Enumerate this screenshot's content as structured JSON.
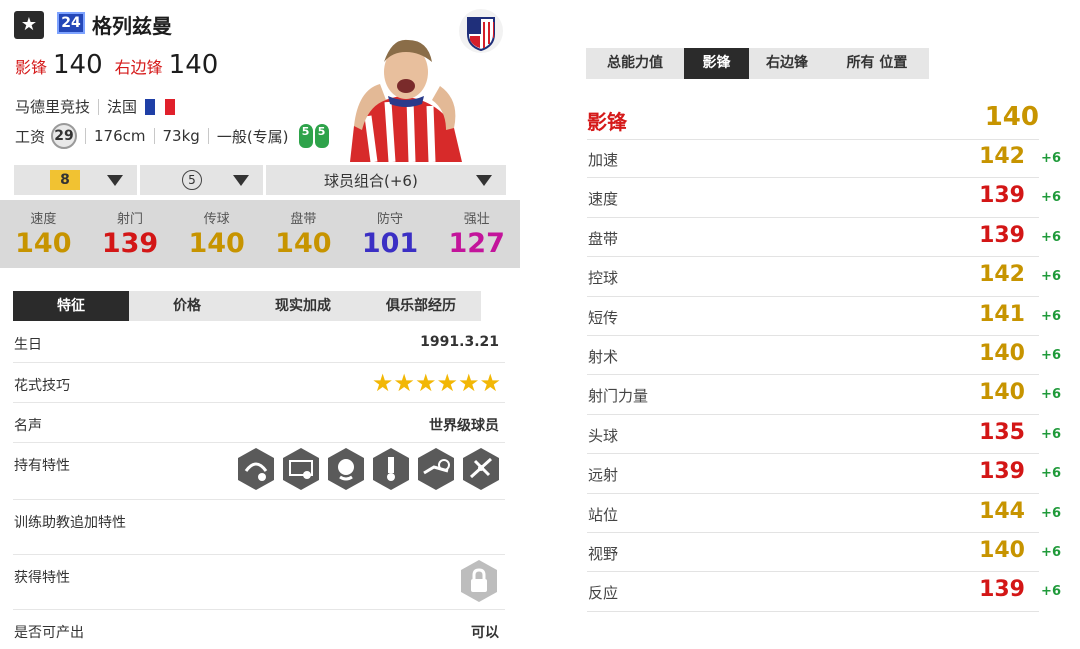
{
  "header": {
    "season_number": "24",
    "player_name": "格列兹曼",
    "positions": [
      {
        "name": "影锋",
        "value": "140"
      },
      {
        "name": "右边锋",
        "value": "140"
      }
    ],
    "club": "马德里竞技",
    "nation": "法国",
    "wage_label": "工资",
    "wage": "29",
    "height": "176cm",
    "weight": "73kg",
    "body_type": "一般(专属)",
    "weak_foot": "5",
    "skill_foot": "5"
  },
  "upgrade": {
    "level": "8",
    "team_color_count": "5",
    "chemistry_label": "球员组合(+6)"
  },
  "main_stats": [
    {
      "label": "速度",
      "value": "140",
      "color": "#c79400"
    },
    {
      "label": "射门",
      "value": "139",
      "color": "#d31616"
    },
    {
      "label": "传球",
      "value": "140",
      "color": "#c79400"
    },
    {
      "label": "盘带",
      "value": "140",
      "color": "#c79400"
    },
    {
      "label": "防守",
      "value": "101",
      "color": "#3b2fc4"
    },
    {
      "label": "强壮",
      "value": "127",
      "color": "#c3149b"
    }
  ],
  "left_tabs": [
    "特征",
    "价格",
    "现实加成",
    "俱乐部经历"
  ],
  "info": {
    "birthday_label": "生日",
    "birthday": "1991.3.21",
    "skill_moves_label": "花式技巧",
    "skill_moves_stars": 6,
    "reputation_label": "名声",
    "reputation": "世界级球员",
    "traits_label": "持有特性",
    "traits_icons": [
      "trait-dribble-icon",
      "trait-finesse-icon",
      "trait-leader-icon",
      "trait-solid-player-icon",
      "trait-speed-dribbler-icon",
      "trait-playmaker-icon"
    ],
    "coach_traits_label": "训练助教追加特性",
    "acquired_traits_label": "获得特性",
    "producible_label": "是否可产出",
    "producible": "可以"
  },
  "right_tabs": [
    "总能力值",
    "影锋",
    "右边锋",
    "所有 位置"
  ],
  "position_header": {
    "name": "影锋",
    "value": "140"
  },
  "attributes": [
    {
      "name": "加速",
      "value": "142",
      "bonus": "+6",
      "color": "#c79400"
    },
    {
      "name": "速度",
      "value": "139",
      "bonus": "+6",
      "color": "#d31616"
    },
    {
      "name": "盘带",
      "value": "139",
      "bonus": "+6",
      "color": "#d31616"
    },
    {
      "name": "控球",
      "value": "142",
      "bonus": "+6",
      "color": "#c79400"
    },
    {
      "name": "短传",
      "value": "141",
      "bonus": "+6",
      "color": "#c79400"
    },
    {
      "name": "射术",
      "value": "140",
      "bonus": "+6",
      "color": "#c79400"
    },
    {
      "name": "射门力量",
      "value": "140",
      "bonus": "+6",
      "color": "#c79400"
    },
    {
      "name": "头球",
      "value": "135",
      "bonus": "+6",
      "color": "#d31616"
    },
    {
      "name": "远射",
      "value": "139",
      "bonus": "+6",
      "color": "#d31616"
    },
    {
      "name": "站位",
      "value": "144",
      "bonus": "+6",
      "color": "#c79400"
    },
    {
      "name": "视野",
      "value": "140",
      "bonus": "+6",
      "color": "#c79400"
    },
    {
      "name": "反应",
      "value": "139",
      "bonus": "+6",
      "color": "#d31616"
    }
  ]
}
